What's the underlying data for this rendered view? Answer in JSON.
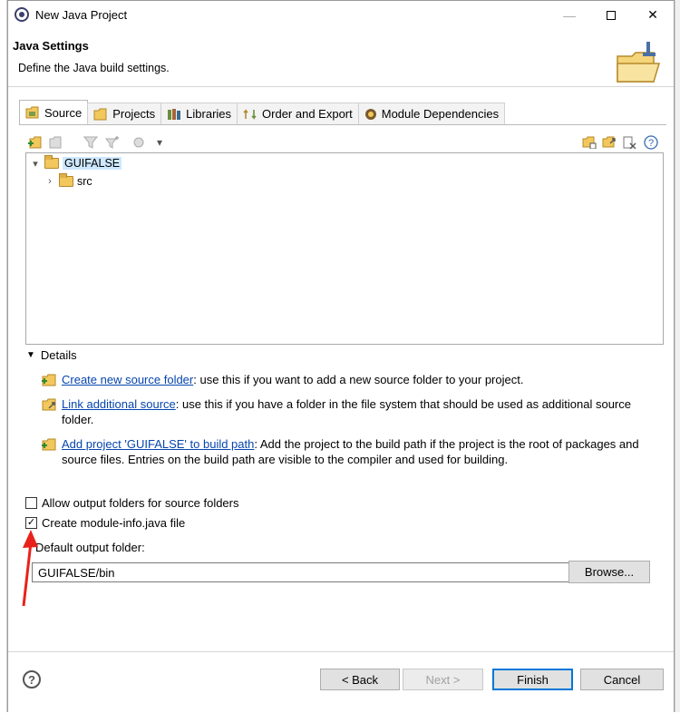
{
  "window": {
    "title": "New Java Project",
    "minimize": "—",
    "close": "✕"
  },
  "header": {
    "title": "Java Settings",
    "description": "Define the Java build settings."
  },
  "tabs": [
    {
      "label": "Source",
      "icon": "source-folder-icon",
      "active": true
    },
    {
      "label": "Projects",
      "icon": "projects-icon",
      "active": false
    },
    {
      "label": "Libraries",
      "icon": "libraries-icon",
      "active": false
    },
    {
      "label": "Order and Export",
      "icon": "order-export-icon",
      "active": false
    },
    {
      "label": "Module Dependencies",
      "icon": "module-icon",
      "active": false
    }
  ],
  "tree": {
    "project": "GUIFALSE",
    "child": "src"
  },
  "details": {
    "heading": "Details",
    "items": [
      {
        "link": "Create new source folder",
        "text": ": use this if you want to add a new source folder to your project."
      },
      {
        "link": "Link additional source",
        "text": ": use this if you have a folder in the file system that should be used as additional source folder."
      },
      {
        "link": "Add project 'GUIFALSE' to build path",
        "text": ": Add the project to the build path if the project is the root of packages and source files. Entries on the build path are visible to the compiler and used for building."
      }
    ]
  },
  "options": {
    "allow_output": {
      "label": "Allow output folders for source folders",
      "checked": false
    },
    "create_module": {
      "label": "Create module-info.java file",
      "checked": true
    }
  },
  "output": {
    "label": "Default output folder:",
    "value": "GUIFALSE/bin",
    "browse": "Browse..."
  },
  "footer": {
    "help": "?",
    "back": "< Back",
    "next": "Next >",
    "finish": "Finish",
    "cancel": "Cancel"
  },
  "colors": {
    "link": "#0645ad",
    "selection": "#cde8ff",
    "annotation_arrow": "#e8221a",
    "primary_border": "#0078d7"
  }
}
